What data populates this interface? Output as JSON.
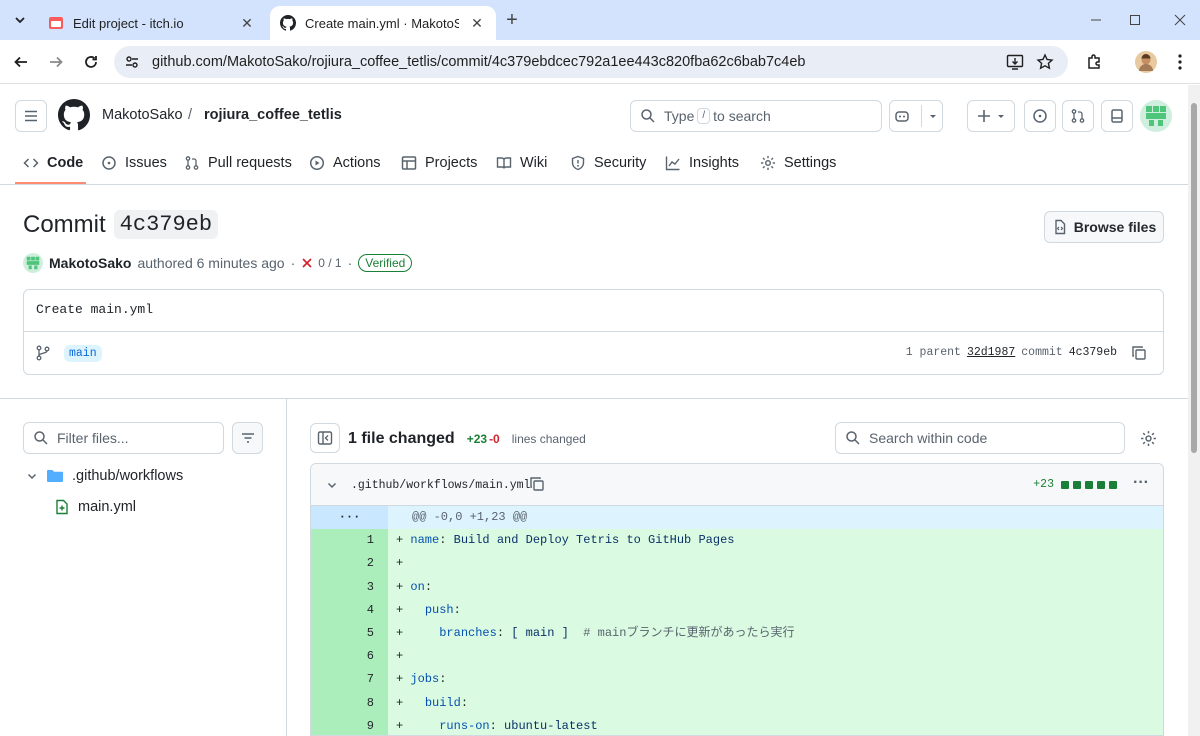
{
  "browser": {
    "tabs": [
      {
        "title": "Edit project - itch.io",
        "active": false
      },
      {
        "title": "Create main.yml · MakotoSako/",
        "active": true
      }
    ],
    "new_tab": "+",
    "url": "github.com/MakotoSako/rojiura_coffee_tetlis/commit/4c379ebdcec792a1ee443c820fba62c6bab7c4eb"
  },
  "github": {
    "owner": "MakotoSako",
    "separator": "/",
    "repo": "rojiura_coffee_tetlis",
    "search": {
      "prefix": "Type",
      "key": "/",
      "suffix": "to search"
    },
    "nav": [
      "Code",
      "Issues",
      "Pull requests",
      "Actions",
      "Projects",
      "Wiki",
      "Security",
      "Insights",
      "Settings"
    ]
  },
  "commit": {
    "title_label": "Commit",
    "short_sha": "4c379eb",
    "browse_files": "Browse files",
    "author": "MakotoSako",
    "authored_text": "authored 6 minutes ago",
    "dot": "·",
    "checks": "0 / 1",
    "verified": "Verified",
    "message": "Create main.yml",
    "branch": "main",
    "parent_label": "1 parent",
    "parent_sha": "32d1987",
    "commit_label": "commit",
    "commit_sha": "4c379eb"
  },
  "sidebar": {
    "filter_placeholder": "Filter files...",
    "folder": ".github/workflows",
    "file": "main.yml"
  },
  "diff": {
    "summary": "1 file changed",
    "additions": "+23",
    "deletions": "-0",
    "lines_changed": "lines changed",
    "search_placeholder": "Search within code",
    "file_path": ".github/workflows/main.yml",
    "file_additions": "+23",
    "more": "···",
    "hunk_gutter": "···",
    "hunk": "@@ -0,0 +1,23 @@",
    "lines": [
      {
        "num": "1",
        "text": "+ name: Build and Deploy Tetris to GitHub Pages"
      },
      {
        "num": "2",
        "text": "+"
      },
      {
        "num": "3",
        "text": "+ on:"
      },
      {
        "num": "4",
        "text": "+   push:"
      },
      {
        "num": "5",
        "text": "+     branches: [ main ]  # mainブランチに更新があったら実行"
      },
      {
        "num": "6",
        "text": "+"
      },
      {
        "num": "7",
        "text": "+ jobs:"
      },
      {
        "num": "8",
        "text": "+   build:"
      },
      {
        "num": "9",
        "text": "+     runs-on: ubuntu-latest"
      }
    ]
  }
}
